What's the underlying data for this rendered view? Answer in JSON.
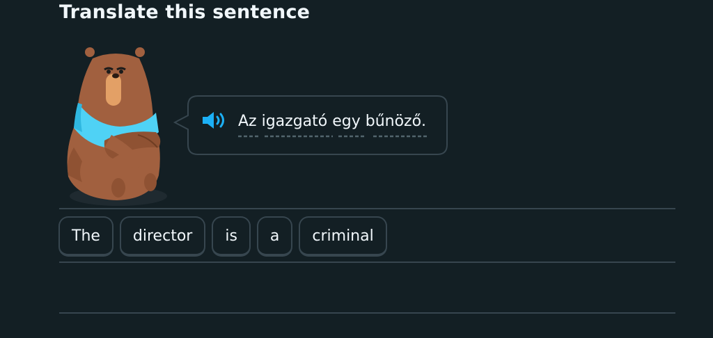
{
  "challenge": {
    "title": "Translate this sentence"
  },
  "prompt": {
    "sentence": "Az igazgató egy bűnöző.",
    "speaker_icon": "speaker-icon",
    "character_icon": "bear-character"
  },
  "answer": {
    "tiles": [
      "The",
      "director",
      "is",
      "a",
      "criminal"
    ]
  },
  "colors": {
    "background": "#131f24",
    "border": "#37464f",
    "speaker": "#1cb0f6",
    "text": "#f1f7fb"
  }
}
